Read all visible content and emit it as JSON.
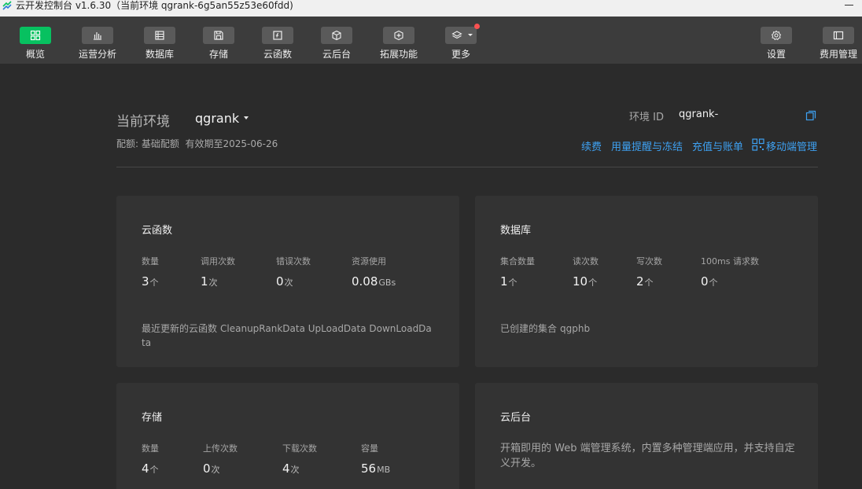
{
  "window": {
    "title": "云开发控制台 v1.6.30（当前环境 qgrank-6g5an55z53e60fdd)"
  },
  "toolbar": {
    "overview": "概览",
    "analytics": "运营分析",
    "database": "数据库",
    "storage": "存储",
    "functions": "云函数",
    "backend": "云后台",
    "extensions": "拓展功能",
    "more": "更多",
    "settings": "设置",
    "billing": "费用管理",
    "active_color": "#07c160",
    "notification_color": "#fa5151"
  },
  "env": {
    "label": "当前环境",
    "name": "qgrank",
    "quota_label": "配额: 基础配额",
    "validity": "有效期至2025-06-26",
    "id_label": "环境 ID",
    "id_value": "qgrank-6"
  },
  "links": {
    "renew": "续费",
    "usage_alert": "用量提醒与冻结",
    "recharge": "充值与账单",
    "mobile_admin": "移动端管理",
    "color": "#3ea1f2"
  },
  "functions_card": {
    "title": "云函数",
    "stats": [
      {
        "label": "数量",
        "value": "3",
        "unit": "个"
      },
      {
        "label": "调用次数",
        "value": "1",
        "unit": "次"
      },
      {
        "label": "错误次数",
        "value": "0",
        "unit": "次"
      },
      {
        "label": "资源使用",
        "value": "0.08",
        "unit": "GBs"
      }
    ],
    "recent_label": "最近更新的云函数",
    "recent_value": "CleanupRankData UpLoadData DownLoadData"
  },
  "database_card": {
    "title": "数据库",
    "stats": [
      {
        "label": "集合数量",
        "value": "1",
        "unit": "个"
      },
      {
        "label": "读次数",
        "value": "10",
        "unit": "个"
      },
      {
        "label": "写次数",
        "value": "2",
        "unit": "个"
      },
      {
        "label": "100ms 请求数",
        "value": "0",
        "unit": "个"
      }
    ],
    "collections_label": "已创建的集合",
    "collections_value": "qgphb"
  },
  "storage_card": {
    "title": "存储",
    "stats": [
      {
        "label": "数量",
        "value": "4",
        "unit": "个"
      },
      {
        "label": "上传次数",
        "value": "0",
        "unit": "次"
      },
      {
        "label": "下载次数",
        "value": "4",
        "unit": "次"
      },
      {
        "label": "容量",
        "value": "56",
        "unit": "MB"
      }
    ]
  },
  "backend_card": {
    "title": "云后台",
    "description": "开箱即用的 Web 端管理系统，内置多种管理端应用，并支持自定义开发。"
  }
}
